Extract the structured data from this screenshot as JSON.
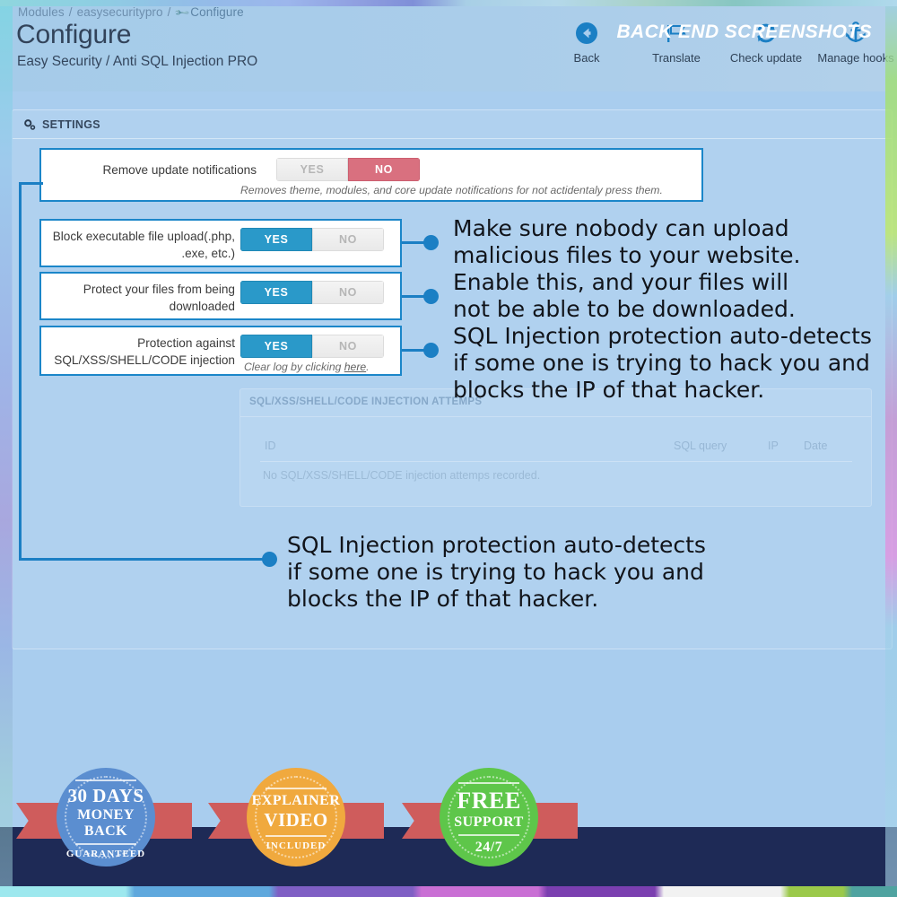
{
  "header": {
    "breadcrumb": [
      {
        "label": "Modules",
        "icon": null
      },
      {
        "label": "easysecuritypro",
        "icon": null
      },
      {
        "label": "Configure",
        "icon": "wrench-icon"
      }
    ],
    "separator": "/",
    "title": "Configure",
    "subtitle": "Easy Security / Anti SQL Injection PRO",
    "toolbar": [
      {
        "label": "Back",
        "icon": "arrow-circle-left-icon"
      },
      {
        "label": "Translate",
        "icon": "flag-icon"
      },
      {
        "label": "Check update",
        "icon": "refresh-icon"
      },
      {
        "label": "Manage hooks",
        "icon": "anchor-icon"
      }
    ]
  },
  "panel": {
    "icon": "gears-icon",
    "title": "SETTINGS",
    "rows": [
      {
        "label": "Remove update notifications",
        "toggle": {
          "yes": "YES",
          "no": "NO",
          "selected": "NO"
        },
        "hint": "Removes theme, modules, and core update notifications for not actidentaly press them.",
        "hint_link": null
      },
      {
        "label": "Block executable file upload(.php, .exe, etc.)",
        "toggle": {
          "yes": "YES",
          "no": "NO",
          "selected": "YES"
        },
        "hint": null,
        "hint_link": null
      },
      {
        "label": "Protect your files from being downloaded",
        "toggle": {
          "yes": "YES",
          "no": "NO",
          "selected": "YES"
        },
        "hint": null,
        "hint_link": null
      },
      {
        "label": "Protection against SQL/XSS/SHELL/CODE injection",
        "toggle": {
          "yes": "YES",
          "no": "NO",
          "selected": "YES"
        },
        "hint_pre": "Clear log by clicking ",
        "hint_link": "here",
        "hint_post": "."
      }
    ]
  },
  "attempts_table": {
    "title": "SQL/XSS/SHELL/CODE INJECTION ATTEMPS",
    "columns": [
      "ID",
      "SQL query",
      "IP",
      "Date"
    ],
    "empty_message": "No SQL/XSS/SHELL/CODE injection attemps recorded."
  },
  "callouts": [
    {
      "id": "upload-protection-callout",
      "text": "Make sure nobody can upload\nmalicious files to your website.\nEnable this, and your files will\nnot be able to be downloaded.\nSQL Injection protection auto-detects\nif some one is trying to hack you and\nblocks the IP of that hacker."
    },
    {
      "id": "sql-injection-callout",
      "text": "SQL Injection protection auto-detects\nif some one is trying to hack you and\nblocks the IP of that hacker."
    }
  ],
  "promo": {
    "label": "BACK END SCREENSHOTS",
    "badges": [
      {
        "line1": "30 DAYS",
        "line2": "MONEY BACK",
        "line3": "GUARANTEED",
        "color": "#5b8ed0"
      },
      {
        "line1": "EXPLAINER",
        "line2": "VIDEO",
        "line3": "INCLUDED",
        "color": "#f0a93e"
      },
      {
        "line1": "FREE",
        "line2": "SUPPORT",
        "line3": "24/7",
        "color": "#5ec64a"
      }
    ],
    "ribbon_color": "#cf5c5c"
  },
  "colors": {
    "accent_blue": "#1b86c9",
    "toggle_on": "#2a99c9",
    "toggle_no": "#d9707f",
    "page_bg": "#a9cdee",
    "promo_bg": "#1e2a56"
  }
}
